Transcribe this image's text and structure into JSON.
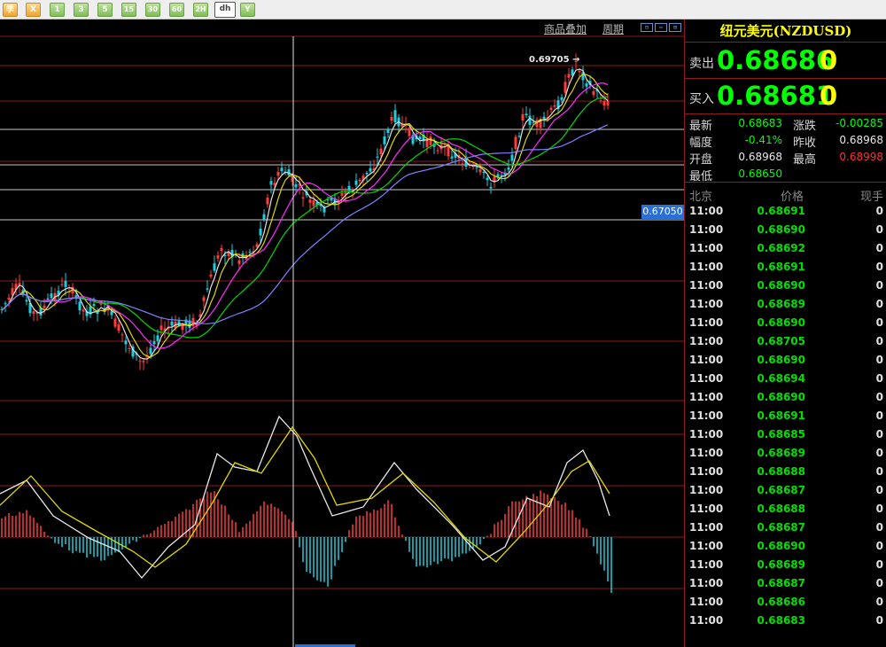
{
  "toolbar": {
    "buttons": [
      {
        "label": "季",
        "style": "orange"
      },
      {
        "label": "X",
        "style": "orange"
      },
      {
        "label": "1",
        "style": "green"
      },
      {
        "label": "3",
        "style": "green"
      },
      {
        "label": "5",
        "style": "green"
      },
      {
        "label": "15",
        "style": "green"
      },
      {
        "label": "30",
        "style": "green"
      },
      {
        "label": "60",
        "style": "green"
      },
      {
        "label": "2H",
        "style": "green"
      },
      {
        "label": "dh",
        "style": "active"
      },
      {
        "label": "Y",
        "style": "green"
      }
    ]
  },
  "chart": {
    "overlay_link": "商品叠加",
    "period_link": "周期",
    "peak_label": "0.69705",
    "price_tag": "0.67050",
    "colors": {
      "up": "#ff3b3b",
      "down": "#19d0e0",
      "ma1": "#e0e0e0",
      "ma2": "#e0d800",
      "ma3": "#ff2bff",
      "ma4": "#00d800",
      "ma5": "#8080ff",
      "grid": "#8b1a1a",
      "hline": "#c8c8c8",
      "macd_dif": "#e8e8e8",
      "macd_dea": "#e0d800"
    }
  },
  "quote": {
    "title": "纽元美元(NZDUSD)",
    "sell_label": "卖出",
    "sell_price": "0.68686",
    "sell_vol": "0",
    "buy_label": "买入",
    "buy_price": "0.68681",
    "buy_vol": "0"
  },
  "stats": {
    "latest_label": "最新",
    "latest": "0.68683",
    "change_label": "涨跌",
    "change": "-0.00285",
    "amplitude_label": "幅度",
    "amplitude": "-0.41%",
    "prev_close_label": "昨收",
    "prev_close": "0.68968",
    "open_label": "开盘",
    "open": "0.68968",
    "high_label": "最高",
    "high": "0.68998",
    "low_label": "最低",
    "low": "0.68650"
  },
  "ticks": {
    "headers": {
      "time": "北京",
      "price": "价格",
      "volume": "现手"
    },
    "rows": [
      {
        "time": "11:00",
        "price": "0.68691",
        "vol": "0"
      },
      {
        "time": "11:00",
        "price": "0.68690",
        "vol": "0"
      },
      {
        "time": "11:00",
        "price": "0.68692",
        "vol": "0"
      },
      {
        "time": "11:00",
        "price": "0.68691",
        "vol": "0"
      },
      {
        "time": "11:00",
        "price": "0.68690",
        "vol": "0"
      },
      {
        "time": "11:00",
        "price": "0.68689",
        "vol": "0"
      },
      {
        "time": "11:00",
        "price": "0.68690",
        "vol": "0"
      },
      {
        "time": "11:00",
        "price": "0.68705",
        "vol": "0"
      },
      {
        "time": "11:00",
        "price": "0.68690",
        "vol": "0"
      },
      {
        "time": "11:00",
        "price": "0.68694",
        "vol": "0"
      },
      {
        "time": "11:00",
        "price": "0.68690",
        "vol": "0"
      },
      {
        "time": "11:00",
        "price": "0.68691",
        "vol": "0"
      },
      {
        "time": "11:00",
        "price": "0.68685",
        "vol": "0"
      },
      {
        "time": "11:00",
        "price": "0.68689",
        "vol": "0"
      },
      {
        "time": "11:00",
        "price": "0.68688",
        "vol": "0"
      },
      {
        "time": "11:00",
        "price": "0.68687",
        "vol": "0"
      },
      {
        "time": "11:00",
        "price": "0.68688",
        "vol": "0"
      },
      {
        "time": "11:00",
        "price": "0.68687",
        "vol": "0"
      },
      {
        "time": "11:00",
        "price": "0.68690",
        "vol": "0"
      },
      {
        "time": "11:00",
        "price": "0.68689",
        "vol": "0"
      },
      {
        "time": "11:00",
        "price": "0.68687",
        "vol": "0"
      },
      {
        "time": "11:00",
        "price": "0.68686",
        "vol": "0"
      },
      {
        "time": "11:00",
        "price": "0.68683",
        "vol": "0"
      }
    ]
  }
}
